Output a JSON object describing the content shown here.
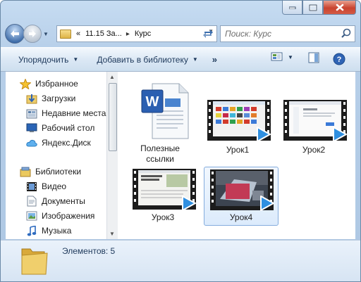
{
  "window": {
    "caption": {
      "minimize": "minimize",
      "maximize": "maximize",
      "close": "close"
    }
  },
  "address": {
    "chevrons": "«",
    "crumb1": "11.15 За...",
    "crumb_sep": "▸",
    "crumb2": "Курс"
  },
  "search": {
    "placeholder": "Поиск: Курс"
  },
  "toolbar": {
    "organize": "Упорядочить",
    "add_library": "Добавить в библиотеку",
    "more": "»"
  },
  "sidebar": {
    "favorites": "Избранное",
    "downloads": "Загрузки",
    "recent": "Недавние места",
    "desktop": "Рабочий стол",
    "yadisk": "Яндекс.Диск",
    "libraries": "Библиотеки",
    "video": "Видео",
    "documents": "Документы",
    "images": "Изображения",
    "music": "Музыка"
  },
  "files": [
    {
      "name": "Полезные ссылки",
      "type": "word"
    },
    {
      "name": "Урок1",
      "type": "video"
    },
    {
      "name": "Урок2",
      "type": "video"
    },
    {
      "name": "Урок3",
      "type": "video"
    },
    {
      "name": "Урок4",
      "type": "video",
      "selected": true
    }
  ],
  "file_labels": {
    "f0a": "Полезные",
    "f0b": "ссылки",
    "f1": "Урок1",
    "f2": "Урок2",
    "f3": "Урок3",
    "f4": "Урок4"
  },
  "status": {
    "items": "Элементов: 5"
  },
  "colors": {
    "accent": "#2e5f9f",
    "play": "#2f8fe0"
  }
}
